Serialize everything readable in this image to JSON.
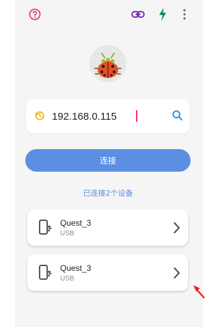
{
  "toolbar": {
    "help_icon": "question-circle-icon",
    "link_icon": "link-icon",
    "bolt_icon": "lightning-bolt-icon",
    "more_icon": "more-vertical-icon"
  },
  "connect_form": {
    "ip_value": "192.168.0.115",
    "history_icon": "history-icon",
    "search_icon": "search-icon",
    "connect_label": "连接",
    "connected_count_text": "已连接2个设备"
  },
  "devices": [
    {
      "name": "Quest_3",
      "type": "USB"
    },
    {
      "name": "Quest_3",
      "type": "USB"
    }
  ],
  "colors": {
    "accent": "#5c8fe2",
    "help": "#e83a8d",
    "link": "#7b2fb8",
    "bolt": "#0f8a6a",
    "history": "#f1b51c",
    "search": "#2f8fe0",
    "pointer": "#ee1d1d"
  }
}
